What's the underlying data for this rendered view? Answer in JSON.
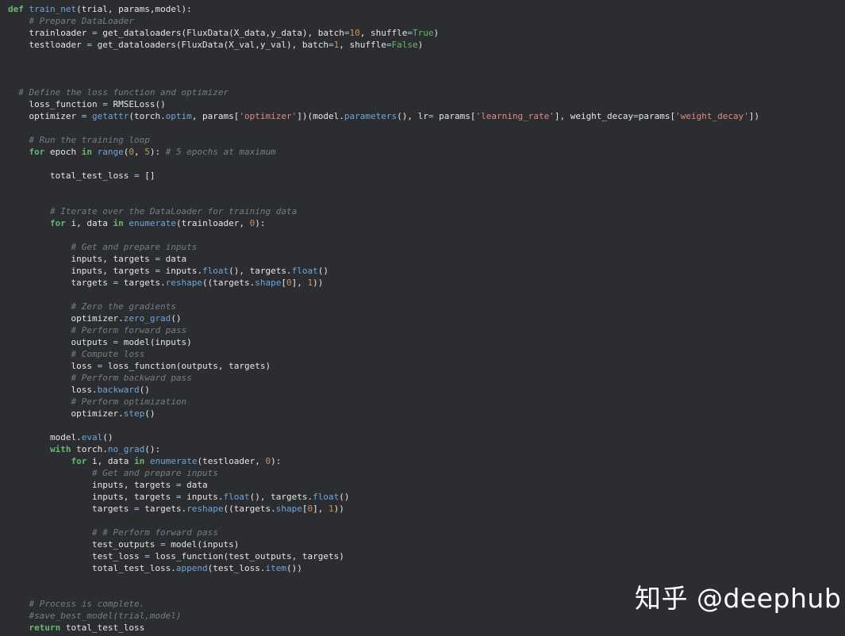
{
  "code_lines": [
    [
      [
        "kw",
        "def"
      ],
      [
        "plain",
        " "
      ],
      [
        "fn",
        "train_net"
      ],
      [
        "plain",
        "(trial, params,model):"
      ]
    ],
    [
      [
        "plain",
        "    "
      ],
      [
        "cm",
        "# Prepare DataLoader"
      ]
    ],
    [
      [
        "plain",
        "    trainloader "
      ],
      [
        "op",
        "="
      ],
      [
        "plain",
        " get_dataloaders(FluxData(X_data,y_data), batch"
      ],
      [
        "op",
        "="
      ],
      [
        "num",
        "10"
      ],
      [
        "plain",
        ", shuffle"
      ],
      [
        "op",
        "="
      ],
      [
        "true",
        "True"
      ],
      [
        "plain",
        ")"
      ]
    ],
    [
      [
        "plain",
        "    testloader "
      ],
      [
        "op",
        "="
      ],
      [
        "plain",
        " get_dataloaders(FluxData(X_val,y_val), batch"
      ],
      [
        "op",
        "="
      ],
      [
        "num",
        "1"
      ],
      [
        "plain",
        ", shuffle"
      ],
      [
        "op",
        "="
      ],
      [
        "true",
        "False"
      ],
      [
        "plain",
        ")"
      ]
    ],
    [],
    [],
    [],
    [
      [
        "plain",
        "  "
      ],
      [
        "cm",
        "# Define the loss function and optimizer"
      ]
    ],
    [
      [
        "plain",
        "    loss_function "
      ],
      [
        "op",
        "="
      ],
      [
        "plain",
        " RMSELoss()"
      ]
    ],
    [
      [
        "plain",
        "    optimizer "
      ],
      [
        "op",
        "="
      ],
      [
        "plain",
        " "
      ],
      [
        "builtin",
        "getattr"
      ],
      [
        "plain",
        "(torch."
      ],
      [
        "attr",
        "optim"
      ],
      [
        "plain",
        ", params["
      ],
      [
        "str",
        "'optimizer'"
      ],
      [
        "plain",
        "])(model."
      ],
      [
        "attr",
        "parameters"
      ],
      [
        "plain",
        "(), lr"
      ],
      [
        "op",
        "="
      ],
      [
        "plain",
        " params["
      ],
      [
        "str",
        "'learning_rate'"
      ],
      [
        "plain",
        "], weight_decay"
      ],
      [
        "op",
        "="
      ],
      [
        "plain",
        "params["
      ],
      [
        "str",
        "'weight_decay'"
      ],
      [
        "plain",
        "])"
      ]
    ],
    [],
    [
      [
        "plain",
        "    "
      ],
      [
        "cm",
        "# Run the training loop"
      ]
    ],
    [
      [
        "plain",
        "    "
      ],
      [
        "kw",
        "for"
      ],
      [
        "plain",
        " epoch "
      ],
      [
        "kw",
        "in"
      ],
      [
        "plain",
        " "
      ],
      [
        "builtin",
        "range"
      ],
      [
        "plain",
        "("
      ],
      [
        "num",
        "0"
      ],
      [
        "plain",
        ", "
      ],
      [
        "num",
        "5"
      ],
      [
        "plain",
        "): "
      ],
      [
        "cm",
        "# 5 epochs at maximum"
      ]
    ],
    [],
    [
      [
        "plain",
        "        total_test_loss "
      ],
      [
        "op",
        "="
      ],
      [
        "plain",
        " []"
      ]
    ],
    [],
    [],
    [
      [
        "plain",
        "        "
      ],
      [
        "cm",
        "# Iterate over the DataLoader for training data"
      ]
    ],
    [
      [
        "plain",
        "        "
      ],
      [
        "kw",
        "for"
      ],
      [
        "plain",
        " i, data "
      ],
      [
        "kw",
        "in"
      ],
      [
        "plain",
        " "
      ],
      [
        "builtin",
        "enumerate"
      ],
      [
        "plain",
        "(trainloader, "
      ],
      [
        "num",
        "0"
      ],
      [
        "plain",
        "):"
      ]
    ],
    [],
    [
      [
        "plain",
        "            "
      ],
      [
        "cm",
        "# Get and prepare inputs"
      ]
    ],
    [
      [
        "plain",
        "            inputs, targets "
      ],
      [
        "op",
        "="
      ],
      [
        "plain",
        " data"
      ]
    ],
    [
      [
        "plain",
        "            inputs, targets "
      ],
      [
        "op",
        "="
      ],
      [
        "plain",
        " inputs."
      ],
      [
        "attr",
        "float"
      ],
      [
        "plain",
        "(), targets."
      ],
      [
        "attr",
        "float"
      ],
      [
        "plain",
        "()"
      ]
    ],
    [
      [
        "plain",
        "            targets "
      ],
      [
        "op",
        "="
      ],
      [
        "plain",
        " targets."
      ],
      [
        "attr",
        "reshape"
      ],
      [
        "plain",
        "((targets."
      ],
      [
        "attr",
        "shape"
      ],
      [
        "plain",
        "["
      ],
      [
        "num",
        "0"
      ],
      [
        "plain",
        "], "
      ],
      [
        "num",
        "1"
      ],
      [
        "plain",
        "))"
      ]
    ],
    [],
    [
      [
        "plain",
        "            "
      ],
      [
        "cm",
        "# Zero the gradients"
      ]
    ],
    [
      [
        "plain",
        "            optimizer."
      ],
      [
        "attr",
        "zero_grad"
      ],
      [
        "plain",
        "()"
      ]
    ],
    [
      [
        "plain",
        "            "
      ],
      [
        "cm",
        "# Perform forward pass"
      ]
    ],
    [
      [
        "plain",
        "            outputs "
      ],
      [
        "op",
        "="
      ],
      [
        "plain",
        " model(inputs)"
      ]
    ],
    [
      [
        "plain",
        "            "
      ],
      [
        "cm",
        "# Compute loss"
      ]
    ],
    [
      [
        "plain",
        "            loss "
      ],
      [
        "op",
        "="
      ],
      [
        "plain",
        " loss_function(outputs, targets)"
      ]
    ],
    [
      [
        "plain",
        "            "
      ],
      [
        "cm",
        "# Perform backward pass"
      ]
    ],
    [
      [
        "plain",
        "            loss."
      ],
      [
        "attr",
        "backward"
      ],
      [
        "plain",
        "()"
      ]
    ],
    [
      [
        "plain",
        "            "
      ],
      [
        "cm",
        "# Perform optimization"
      ]
    ],
    [
      [
        "plain",
        "            optimizer."
      ],
      [
        "attr",
        "step"
      ],
      [
        "plain",
        "()"
      ]
    ],
    [],
    [
      [
        "plain",
        "        model."
      ],
      [
        "attr",
        "eval"
      ],
      [
        "plain",
        "()"
      ]
    ],
    [
      [
        "plain",
        "        "
      ],
      [
        "kw",
        "with"
      ],
      [
        "plain",
        " torch."
      ],
      [
        "attr",
        "no_grad"
      ],
      [
        "plain",
        "():"
      ]
    ],
    [
      [
        "plain",
        "            "
      ],
      [
        "kw",
        "for"
      ],
      [
        "plain",
        " i, data "
      ],
      [
        "kw",
        "in"
      ],
      [
        "plain",
        " "
      ],
      [
        "builtin",
        "enumerate"
      ],
      [
        "plain",
        "(testloader, "
      ],
      [
        "num",
        "0"
      ],
      [
        "plain",
        "):"
      ]
    ],
    [
      [
        "plain",
        "                "
      ],
      [
        "cm",
        "# Get and prepare inputs"
      ]
    ],
    [
      [
        "plain",
        "                inputs, targets "
      ],
      [
        "op",
        "="
      ],
      [
        "plain",
        " data"
      ]
    ],
    [
      [
        "plain",
        "                inputs, targets "
      ],
      [
        "op",
        "="
      ],
      [
        "plain",
        " inputs."
      ],
      [
        "attr",
        "float"
      ],
      [
        "plain",
        "(), targets."
      ],
      [
        "attr",
        "float"
      ],
      [
        "plain",
        "()"
      ]
    ],
    [
      [
        "plain",
        "                targets "
      ],
      [
        "op",
        "="
      ],
      [
        "plain",
        " targets."
      ],
      [
        "attr",
        "reshape"
      ],
      [
        "plain",
        "((targets."
      ],
      [
        "attr",
        "shape"
      ],
      [
        "plain",
        "["
      ],
      [
        "num",
        "0"
      ],
      [
        "plain",
        "], "
      ],
      [
        "num",
        "1"
      ],
      [
        "plain",
        "))"
      ]
    ],
    [],
    [
      [
        "plain",
        "                "
      ],
      [
        "cm",
        "# # Perform forward pass"
      ]
    ],
    [
      [
        "plain",
        "                test_outputs "
      ],
      [
        "op",
        "="
      ],
      [
        "plain",
        " model(inputs)"
      ]
    ],
    [
      [
        "plain",
        "                test_loss "
      ],
      [
        "op",
        "="
      ],
      [
        "plain",
        " loss_function(test_outputs, targets)"
      ]
    ],
    [
      [
        "plain",
        "                total_test_loss."
      ],
      [
        "attr",
        "append"
      ],
      [
        "plain",
        "(test_loss."
      ],
      [
        "attr",
        "item"
      ],
      [
        "plain",
        "())"
      ]
    ],
    [],
    [],
    [
      [
        "plain",
        "    "
      ],
      [
        "cm",
        "# Process is complete."
      ]
    ],
    [
      [
        "plain",
        "    "
      ],
      [
        "cm",
        "#save_best_model(trial,model)"
      ]
    ],
    [
      [
        "plain",
        "    "
      ],
      [
        "kw",
        "return"
      ],
      [
        "plain",
        " total_test_loss"
      ]
    ]
  ],
  "watermark": {
    "text": "知乎 @deephub"
  }
}
